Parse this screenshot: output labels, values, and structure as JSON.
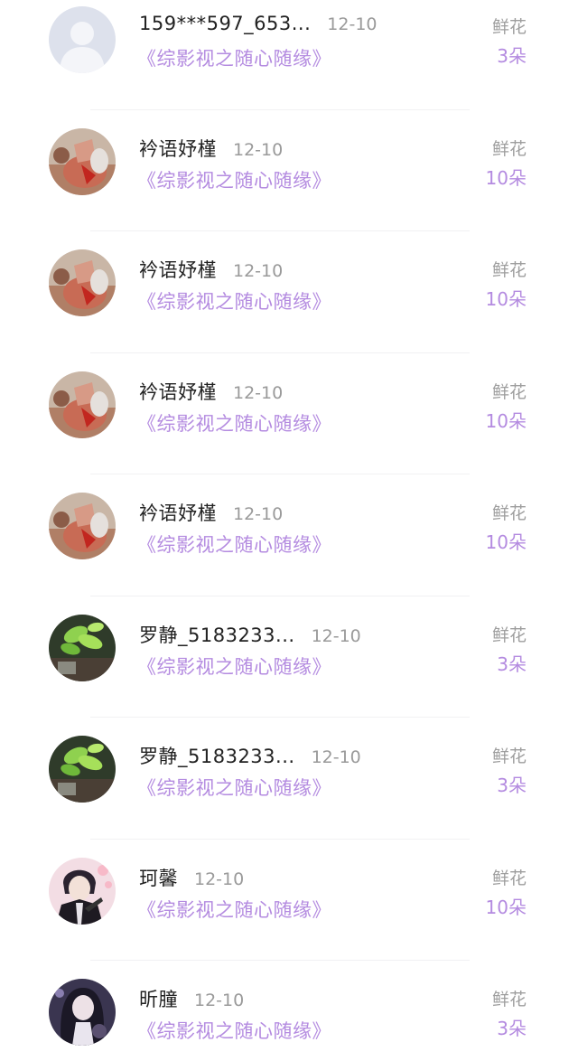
{
  "rows": [
    {
      "avatar": "default-avatar",
      "name": "159***597_653...",
      "date": "12-10",
      "title": "《综影视之随心随缘》",
      "gift": "鲜花",
      "count": "3朵"
    },
    {
      "avatar": "autumn-avatar",
      "name": "衿语妤槿",
      "date": "12-10",
      "title": "《综影视之随心随缘》",
      "gift": "鲜花",
      "count": "10朵"
    },
    {
      "avatar": "autumn-avatar",
      "name": "衿语妤槿",
      "date": "12-10",
      "title": "《综影视之随心随缘》",
      "gift": "鲜花",
      "count": "10朵"
    },
    {
      "avatar": "autumn-avatar",
      "name": "衿语妤槿",
      "date": "12-10",
      "title": "《综影视之随心随缘》",
      "gift": "鲜花",
      "count": "10朵"
    },
    {
      "avatar": "autumn-avatar",
      "name": "衿语妤槿",
      "date": "12-10",
      "title": "《综影视之随心随缘》",
      "gift": "鲜花",
      "count": "10朵"
    },
    {
      "avatar": "plant-avatar",
      "name": "罗静_5183233...",
      "date": "12-10",
      "title": "《综影视之随心随缘》",
      "gift": "鲜花",
      "count": "3朵"
    },
    {
      "avatar": "plant-avatar",
      "name": "罗静_5183233...",
      "date": "12-10",
      "title": "《综影视之随心随缘》",
      "gift": "鲜花",
      "count": "3朵"
    },
    {
      "avatar": "anime-boy-avatar",
      "name": "珂馨",
      "date": "12-10",
      "title": "《综影视之随心随缘》",
      "gift": "鲜花",
      "count": "10朵"
    },
    {
      "avatar": "anime-girl-avatar",
      "name": "昕朣",
      "date": "12-10",
      "title": "《综影视之随心随缘》",
      "gift": "鲜花",
      "count": "3朵"
    }
  ]
}
